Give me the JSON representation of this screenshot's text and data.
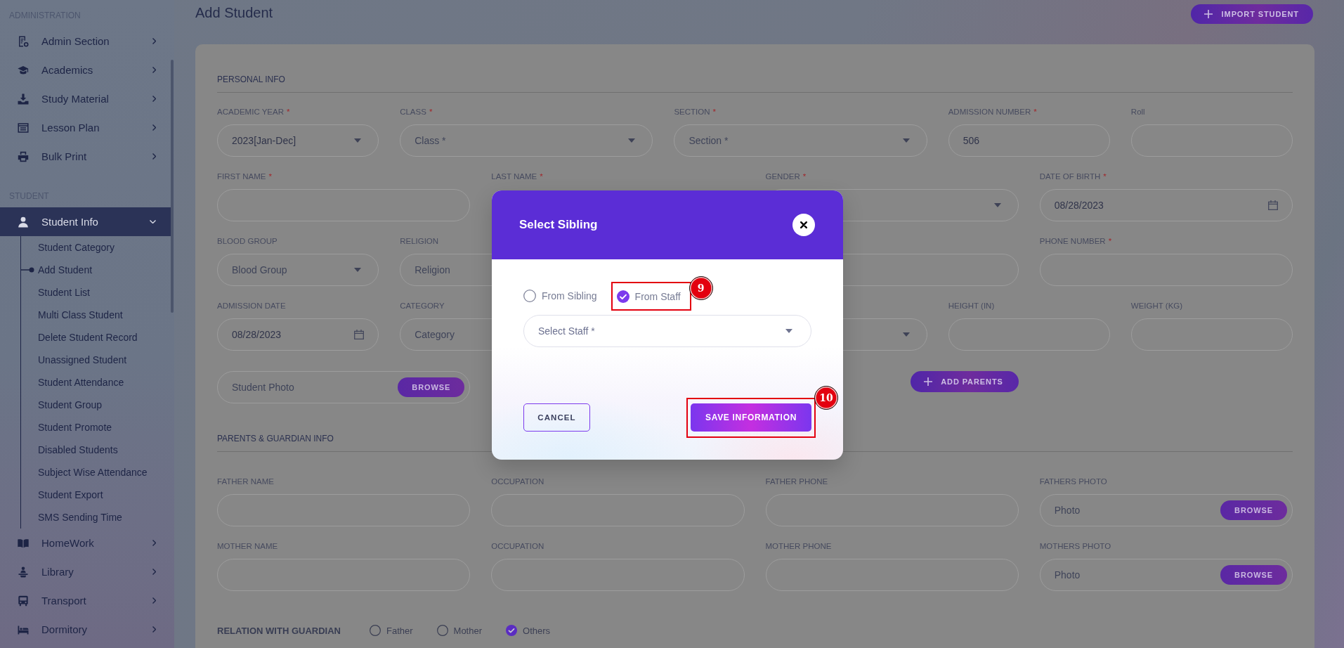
{
  "sidebar": {
    "groups": [
      {
        "title": "ADMINISTRATION",
        "items": [
          {
            "label": "Admin Section",
            "selected": false,
            "expanded": false
          },
          {
            "label": "Academics",
            "selected": false,
            "expanded": false
          },
          {
            "label": "Study Material",
            "selected": false,
            "expanded": false
          },
          {
            "label": "Lesson Plan",
            "selected": false,
            "expanded": false
          },
          {
            "label": "Bulk Print",
            "selected": false,
            "expanded": false
          }
        ]
      },
      {
        "title": "STUDENT",
        "items": [
          {
            "label": "Student Info",
            "selected": true,
            "expanded": true,
            "children": [
              {
                "label": "Student Category",
                "selected": false
              },
              {
                "label": "Add Student",
                "selected": true
              },
              {
                "label": "Student List",
                "selected": false
              },
              {
                "label": "Multi Class Student",
                "selected": false
              },
              {
                "label": "Delete Student Record",
                "selected": false
              },
              {
                "label": "Unassigned Student",
                "selected": false
              },
              {
                "label": "Student Attendance",
                "selected": false
              },
              {
                "label": "Student Group",
                "selected": false
              },
              {
                "label": "Student Promote",
                "selected": false
              },
              {
                "label": "Disabled Students",
                "selected": false
              },
              {
                "label": "Subject Wise Attendance",
                "selected": false
              },
              {
                "label": "Student Export",
                "selected": false
              },
              {
                "label": "SMS Sending Time",
                "selected": false
              }
            ]
          },
          {
            "label": "HomeWork",
            "selected": false,
            "expanded": false
          },
          {
            "label": "Library",
            "selected": false,
            "expanded": false
          },
          {
            "label": "Transport",
            "selected": false,
            "expanded": false
          },
          {
            "label": "Dormitory",
            "selected": false,
            "expanded": false
          }
        ]
      }
    ]
  },
  "header": {
    "title": "Add Student",
    "import_button": "IMPORT STUDENT"
  },
  "form": {
    "sections": [
      {
        "title": "PERSONAL INFO",
        "rows": [
          [
            {
              "label": "ACADEMIC YEAR",
              "required_mark": "*",
              "kind": "select",
              "value": "2023[Jan-Dec]"
            },
            {
              "label": "CLASS",
              "required_mark": "*",
              "kind": "select",
              "placeholder": "Class *"
            },
            {
              "label": "SECTION",
              "required_mark": "*",
              "kind": "select",
              "placeholder": "Section *"
            },
            {
              "label": "ADMISSION NUMBER",
              "required_mark": "*",
              "kind": "text",
              "value": "506"
            },
            {
              "label": "Roll",
              "kind": "text"
            }
          ],
          [
            {
              "label": "FIRST NAME",
              "required_mark": "*",
              "kind": "text"
            },
            {
              "label": "LAST NAME",
              "required_mark": "*"
            },
            {
              "label": "GENDER",
              "required_mark": "*",
              "kind": "select"
            },
            {
              "label": "DATE OF BIRTH",
              "required_mark": "*",
              "kind": "date",
              "value": "08/28/2023"
            }
          ],
          [
            {
              "label": "BLOOD GROUP",
              "kind": "select",
              "placeholder": "Blood Group"
            },
            {
              "label": "RELIGION",
              "kind": "text",
              "placeholder": "Religion"
            },
            {
              "kind": "text"
            },
            {
              "label": "PHONE NUMBER",
              "required_mark": "*",
              "kind": "text"
            }
          ],
          [
            {
              "label": "ADMISSION DATE",
              "kind": "date",
              "value": "08/28/2023"
            },
            {
              "label": "CATEGORY",
              "kind": "text",
              "placeholder": "Category"
            },
            {
              "kind": "select"
            },
            {
              "label": "HEIGHT (IN)",
              "kind": "text"
            },
            {
              "label": "WEIGHT (KG)",
              "kind": "text"
            }
          ],
          [
            {
              "kind": "file",
              "placeholder": "Student Photo",
              "button": "BROWSE"
            },
            {
              "kind": "button",
              "text": "ADD PARENTS"
            }
          ]
        ]
      },
      {
        "title": "PARENTS & GUARDIAN INFO",
        "rows": [
          [
            {
              "label": "FATHER NAME",
              "kind": "text"
            },
            {
              "label": "OCCUPATION",
              "kind": "text"
            },
            {
              "label": "FATHER PHONE",
              "kind": "text"
            },
            {
              "label": "FATHERS PHOTO",
              "kind": "file",
              "placeholder": "Photo",
              "button": "BROWSE"
            }
          ],
          [
            {
              "label": "MOTHER NAME",
              "kind": "text"
            },
            {
              "label": "OCCUPATION",
              "kind": "text"
            },
            {
              "label": "MOTHER PHONE",
              "kind": "text"
            },
            {
              "label": "MOTHERS PHOTO",
              "kind": "file",
              "placeholder": "Photo",
              "button": "BROWSE"
            }
          ]
        ],
        "relation": {
          "label": "RELATION WITH GUARDIAN",
          "options": [
            {
              "label": "Father",
              "selected": false
            },
            {
              "label": "Mother",
              "selected": false
            },
            {
              "label": "Others",
              "selected": true
            }
          ]
        }
      }
    ]
  },
  "modal": {
    "title": "Select Sibling",
    "options": [
      {
        "label": "From Sibling",
        "selected": false
      },
      {
        "label": "From Staff",
        "selected": true,
        "callout": "9"
      }
    ],
    "select": {
      "placeholder": "Select Staff *"
    },
    "buttons": [
      {
        "label": "CANCEL",
        "kind": "outline"
      },
      {
        "label": "SAVE INFORMATION",
        "kind": "primary",
        "callout": "10"
      }
    ]
  }
}
